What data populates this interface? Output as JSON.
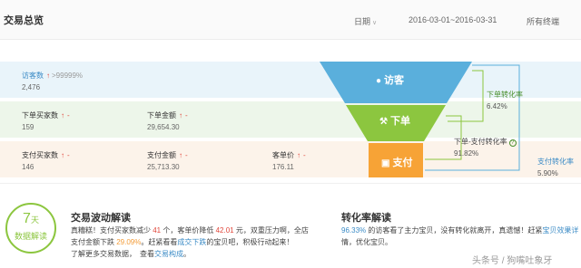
{
  "header": {
    "title": "交易总览",
    "date_label": "日期",
    "date_range": "2016-03-01~2016-03-31",
    "terminal": "所有终端"
  },
  "metrics": {
    "visitors": {
      "label": "访客数",
      "arrow": "↑",
      "change": ">99999%",
      "value": "2,476"
    },
    "order_buyers": {
      "label": "下单买家数",
      "arrow": "↑",
      "change": "-",
      "value": "159"
    },
    "order_amount": {
      "label": "下单金额",
      "arrow": "↑",
      "change": "-",
      "value": "29,654.30"
    },
    "paid_buyers": {
      "label": "支付买家数",
      "arrow": "↑",
      "change": "-",
      "value": "146"
    },
    "paid_amount": {
      "label": "支付金额",
      "arrow": "↑",
      "change": "-",
      "value": "25,713.30"
    },
    "unit_price": {
      "label": "客单价",
      "arrow": "↑",
      "change": "-",
      "value": "176.11"
    }
  },
  "funnel": {
    "stage1": "访客",
    "stage2": "下单",
    "stage3": "支付",
    "colors": {
      "visit": "#5aafdc",
      "order": "#8cc63f",
      "pay": "#f7a336"
    }
  },
  "rates": {
    "order_rate": {
      "name": "下单转化率",
      "value": "6.42%"
    },
    "order_pay_rate": {
      "name": "下单-支付转化率",
      "value": "91.82%"
    },
    "pay_rate": {
      "name": "支付转化率",
      "value": "5.90%"
    }
  },
  "badge": {
    "days": "7",
    "unit": "天",
    "caption": "数据解读"
  },
  "trade": {
    "title": "交易波动解读",
    "l1_a": "真糟糕！支付买家数减少",
    "l1_n1": "41",
    "l1_b": "个，客单价降低",
    "l1_n2": "42.01",
    "l1_c": "元，双重压力啊，全店",
    "l2_a": "支付金额下跌",
    "l2_n1": "29.09%",
    "l2_b": "。赶紧看看",
    "l2_link": "成交下跌",
    "l2_c": "的宝贝吧，积极行动起来！",
    "l3_a": "了解更多交易数据，　查看",
    "l3_link": "交易构成",
    "l3_b": "。"
  },
  "conversion": {
    "title": "转化率解读",
    "l1_n": "96.33%",
    "l1_a": "的访客看了主力宝贝，没有转化就离开，真遗憾！赶紧",
    "l1_link": "宝贝效果详",
    "l2_a": "情，优化宝贝。"
  },
  "watermark": "头条号 / 狗嘴吐象牙"
}
